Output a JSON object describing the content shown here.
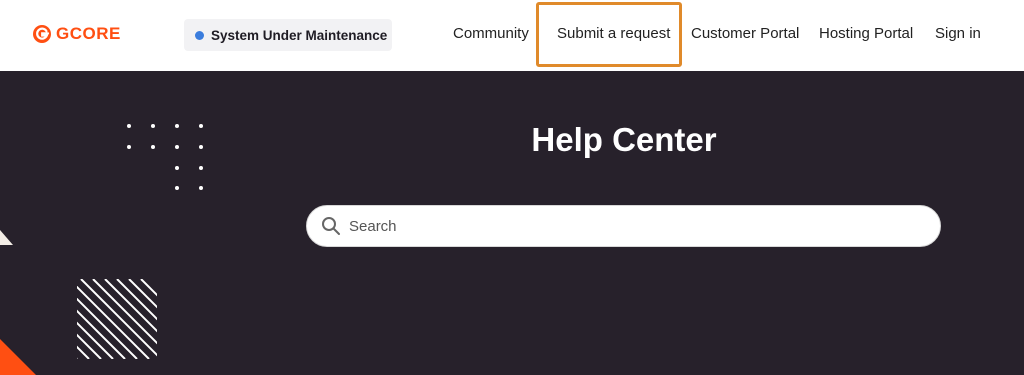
{
  "header": {
    "logo_text": "GCORE",
    "status": {
      "label": "System Under Maintenance",
      "color": "#3b7ddd"
    },
    "nav": [
      {
        "label": "Community"
      },
      {
        "label": "Submit a request"
      },
      {
        "label": "Customer Portal"
      },
      {
        "label": "Hosting Portal"
      },
      {
        "label": "Sign in"
      }
    ],
    "highlight_color": "#e08a2a"
  },
  "hero": {
    "title": "Help Center",
    "search": {
      "placeholder": "Search",
      "icon": "search-icon"
    },
    "background_color": "#27212b"
  },
  "brand": {
    "accent": "#ff4f12"
  }
}
